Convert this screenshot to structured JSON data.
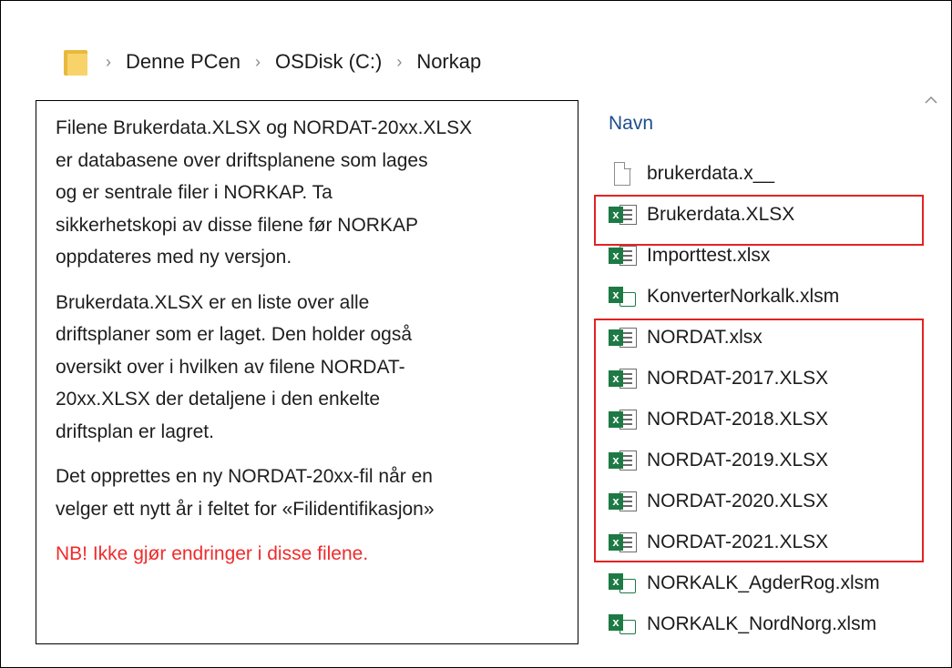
{
  "breadcrumb": {
    "icon": "folder-icon",
    "items": [
      "Denne PCen",
      "OSDisk (C:)",
      "Norkap"
    ],
    "separator": "›"
  },
  "note": {
    "paragraphs": [
      [
        "Filene Brukerdata.XLSX og NORDAT-20xx.XLSX",
        "er databasene over driftsplanene som lages",
        "og er sentrale filer i NORKAP. Ta",
        "sikkerhetskopi av disse filene før NORKAP",
        "oppdateres med ny versjon."
      ],
      [
        "Brukerdata.XLSX er en liste over alle",
        "driftsplaner som er laget. Den holder også",
        "oversikt over i hvilken av filene NORDAT-",
        "20xx.XLSX der detaljene i den enkelte",
        "driftsplan er lagret."
      ],
      [
        "Det opprettes en ny NORDAT-20xx-fil når en",
        "velger ett nytt år i feltet for «Filidentifikasjon»"
      ]
    ],
    "warning": "NB! Ikke gjør endringer i disse filene.",
    "warning_color": "#ef2b2b"
  },
  "file_list": {
    "column_header": "Navn",
    "sort_icon": "chevron-up-icon",
    "files": [
      {
        "name": "brukerdata.x__",
        "icon": "blank-file-icon"
      },
      {
        "name": "Brukerdata.XLSX",
        "icon": "excel-file-icon"
      },
      {
        "name": "Importtest.xlsx",
        "icon": "excel-file-icon"
      },
      {
        "name": "KonverterNorkalk.xlsm",
        "icon": "excel-macro-file-icon"
      },
      {
        "name": "NORDAT.xlsx",
        "icon": "excel-file-icon"
      },
      {
        "name": "NORDAT-2017.XLSX",
        "icon": "excel-file-icon"
      },
      {
        "name": "NORDAT-2018.XLSX",
        "icon": "excel-file-icon"
      },
      {
        "name": "NORDAT-2019.XLSX",
        "icon": "excel-file-icon"
      },
      {
        "name": "NORDAT-2020.XLSX",
        "icon": "excel-file-icon"
      },
      {
        "name": "NORDAT-2021.XLSX",
        "icon": "excel-file-icon"
      },
      {
        "name": "NORKALK_AgderRog.xlsm",
        "icon": "excel-macro-file-icon"
      },
      {
        "name": "NORKALK_NordNorg.xlsm",
        "icon": "excel-macro-file-icon"
      }
    ]
  },
  "highlight_color": "#e32222"
}
